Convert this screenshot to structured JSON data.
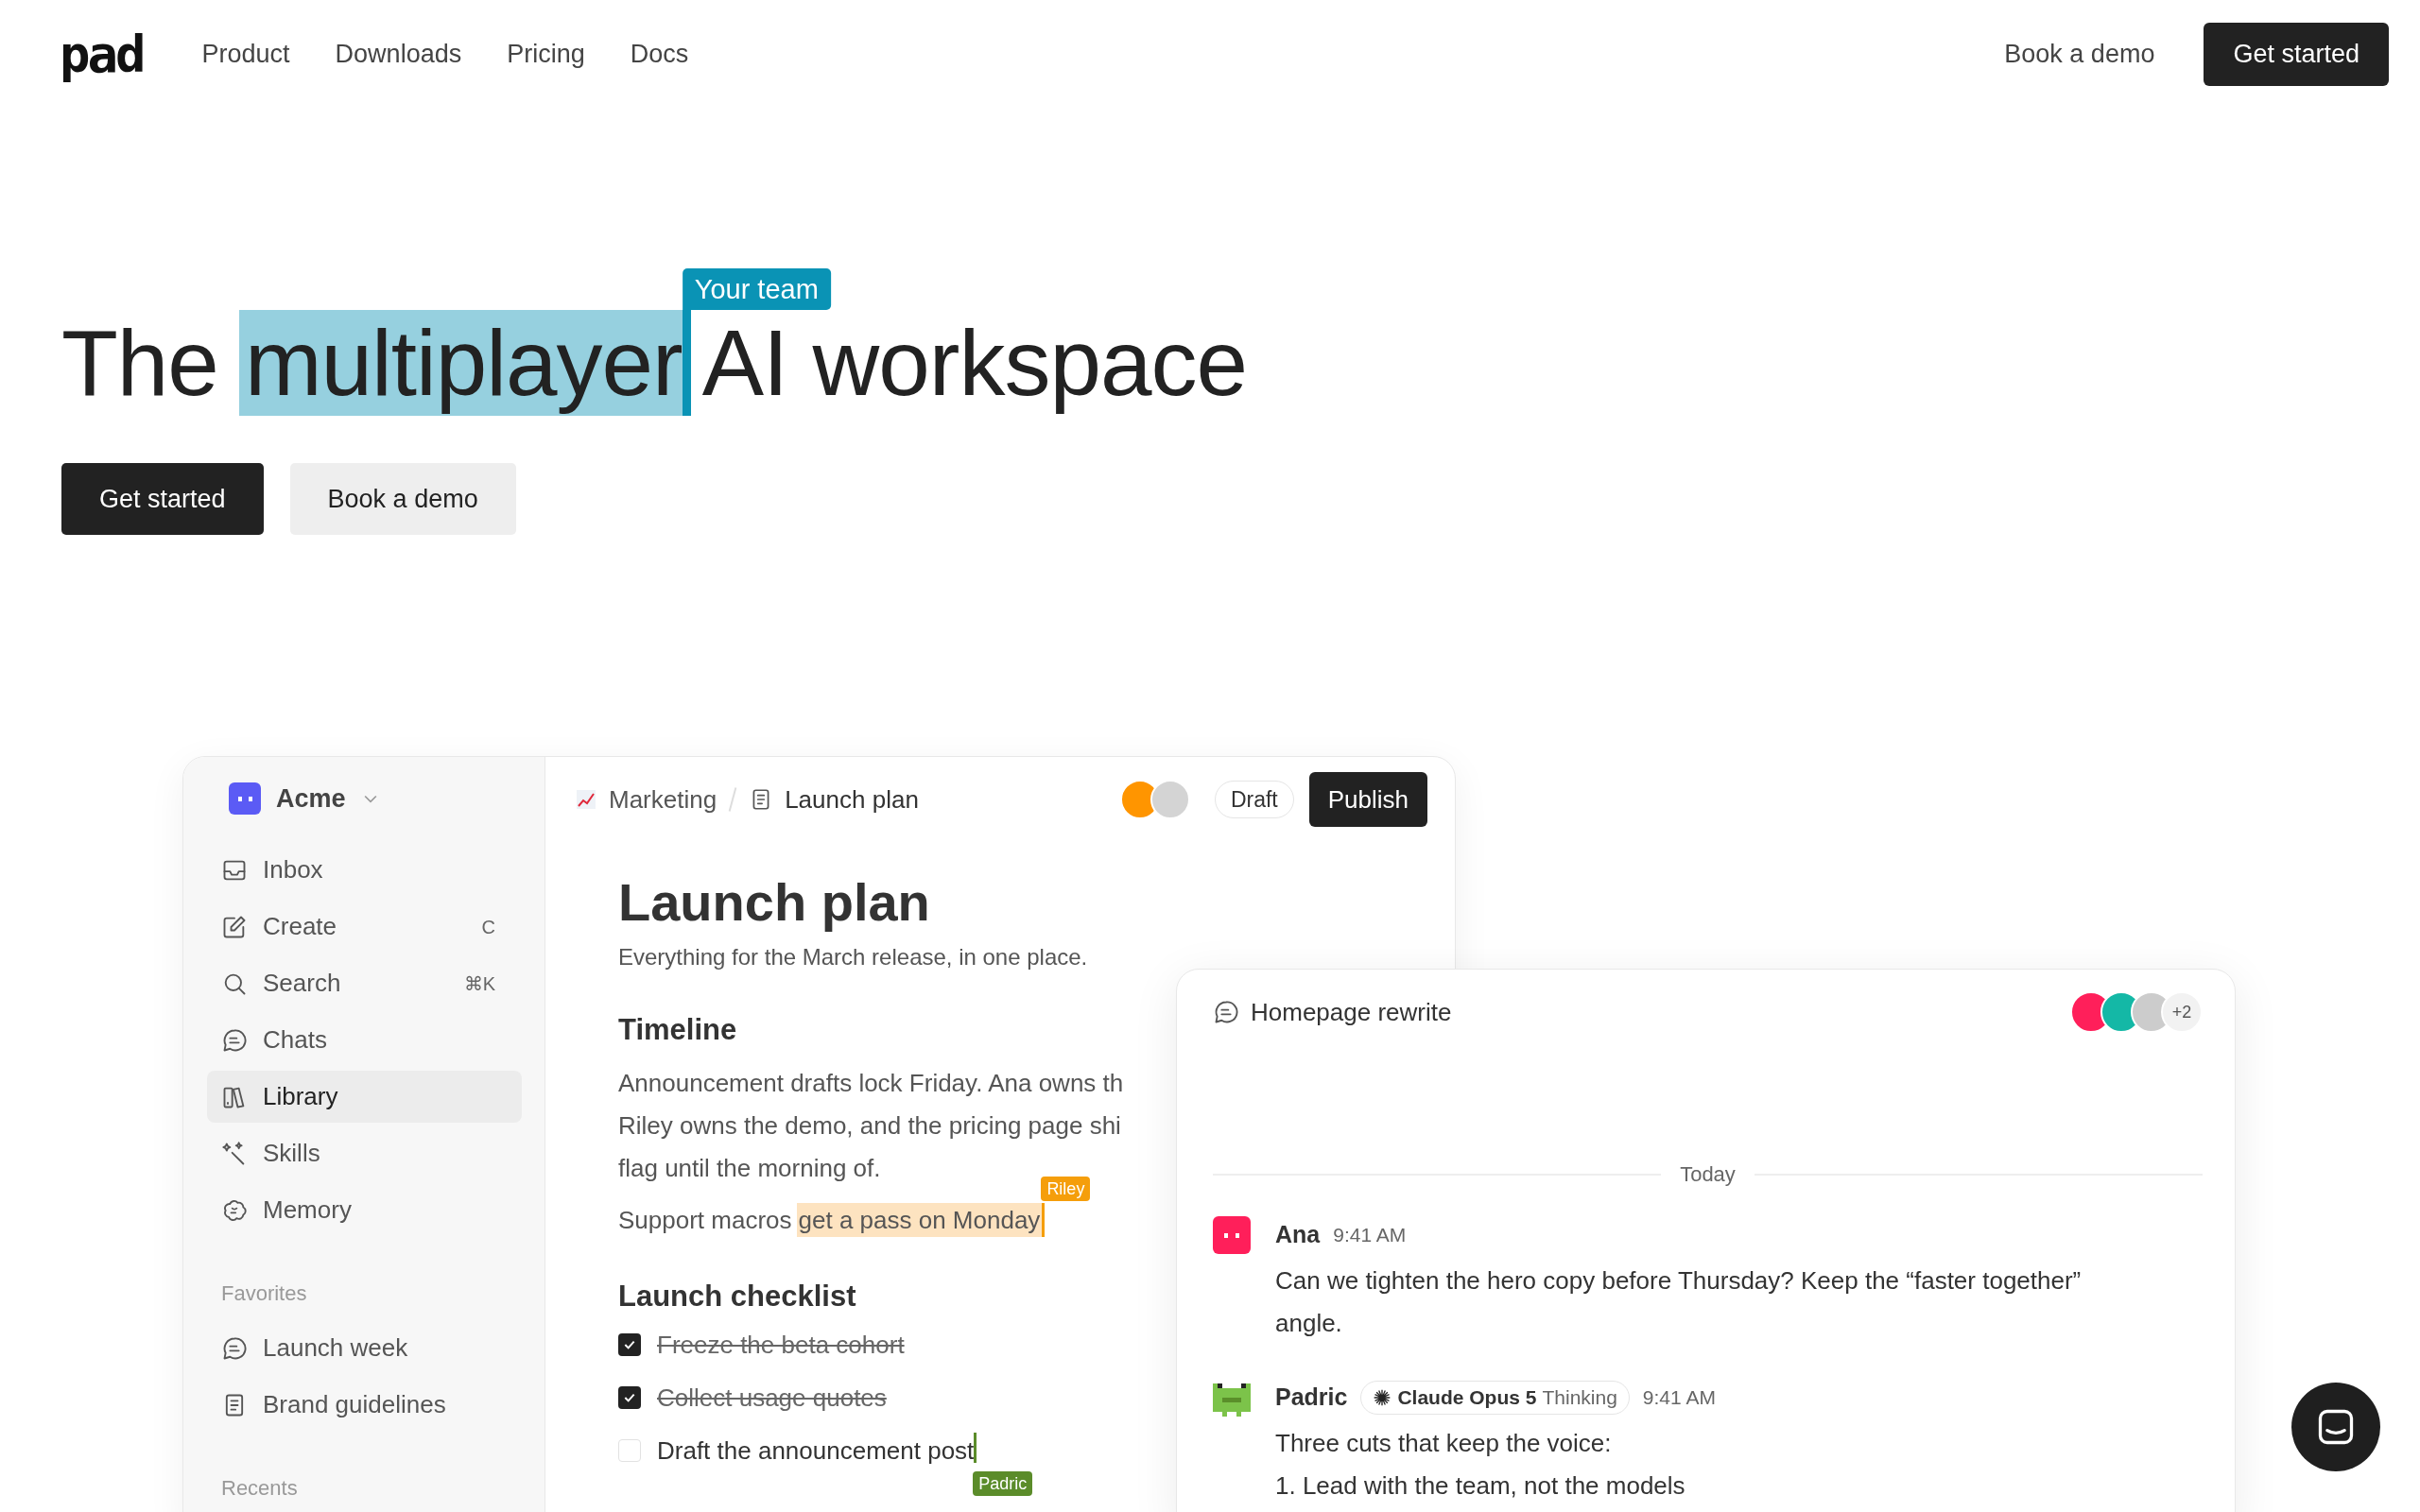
{
  "nav": {
    "logo": "pad",
    "links": [
      "Product",
      "Downloads",
      "Pricing",
      "Docs"
    ],
    "demo": "Book a demo",
    "start": "Get started"
  },
  "hero": {
    "before": "The",
    "highlight": "multiplayer",
    "after": "AI workspace",
    "cursor_label": "Your team",
    "buttons": [
      {
        "label": "Get started",
        "kind": "primary"
      },
      {
        "label": "Book a demo",
        "kind": "secondary"
      }
    ]
  },
  "sidebar": {
    "workspace": "Acme",
    "items": [
      {
        "label": "Inbox",
        "kind": "inbox",
        "selected": false
      },
      {
        "label": "Create",
        "kind": "create",
        "shortcut": "C",
        "selected": false
      },
      {
        "label": "Search",
        "kind": "search",
        "shortcut": "⌘K",
        "selected": false
      },
      {
        "label": "Chats",
        "kind": "chat",
        "selected": false
      },
      {
        "label": "Library",
        "kind": "library",
        "selected": true
      },
      {
        "label": "Skills",
        "kind": "skills",
        "selected": false
      },
      {
        "label": "Memory",
        "kind": "memory",
        "selected": false
      }
    ],
    "favorites_heading": "Favorites",
    "favorites": [
      {
        "label": "Launch week",
        "kind": "chat"
      },
      {
        "label": "Brand guidelines",
        "kind": "doc"
      }
    ],
    "recents_heading": "Recents"
  },
  "document": {
    "breadcrumb": [
      "Marketing",
      "Launch plan"
    ],
    "collaborators": [
      {
        "color": "#ff9500"
      },
      {
        "color": "#d4d4d4"
      }
    ],
    "status": "Draft",
    "publish": "Publish",
    "title": "Launch plan",
    "subtitle": "Everything for the March release, in one place.",
    "timeline_heading": "Timeline",
    "timeline_lines": [
      "Announcement drafts lock Friday. Ana owns th",
      "Riley owns the demo, and the pricing page shi",
      "flag until the morning of."
    ],
    "note": {
      "text": "Support macros",
      "highlight": "get a pass on Monday",
      "cursor": {
        "name": "Riley",
        "color": "#f59e0b"
      }
    },
    "checklist_heading": "Launch checklist",
    "checklist": [
      {
        "label": "Freeze the beta cohort",
        "checked": true
      },
      {
        "label": "Collect usage quotes",
        "checked": true
      },
      {
        "label": "Draft the announcement post",
        "checked": false
      }
    ],
    "checklist_cursor": {
      "name": "Padric",
      "color": "#5b8c2a"
    }
  },
  "chat": {
    "title": "Homepage rewrite",
    "members": [
      {
        "color": "#ff1f5a"
      },
      {
        "color": "#14b8a6"
      },
      {
        "color": "#cccccc"
      }
    ],
    "more": "+2",
    "divider": "Today",
    "messages": [
      {
        "kind": "person",
        "author": "Ana",
        "color": "#ff1f5a",
        "time": "9:41 AM",
        "text": "Can we tighten the hero copy before Thursday? Keep the “faster together” angle."
      },
      {
        "kind": "agent",
        "author": "Padric",
        "color": "#7cc34a",
        "model": "Claude Opus 5",
        "mode": "Thinking",
        "time": "9:41 AM",
        "text": "Three cuts that keep the voice:",
        "list": [
          "1. Lead with the team, not the models"
        ]
      }
    ]
  }
}
